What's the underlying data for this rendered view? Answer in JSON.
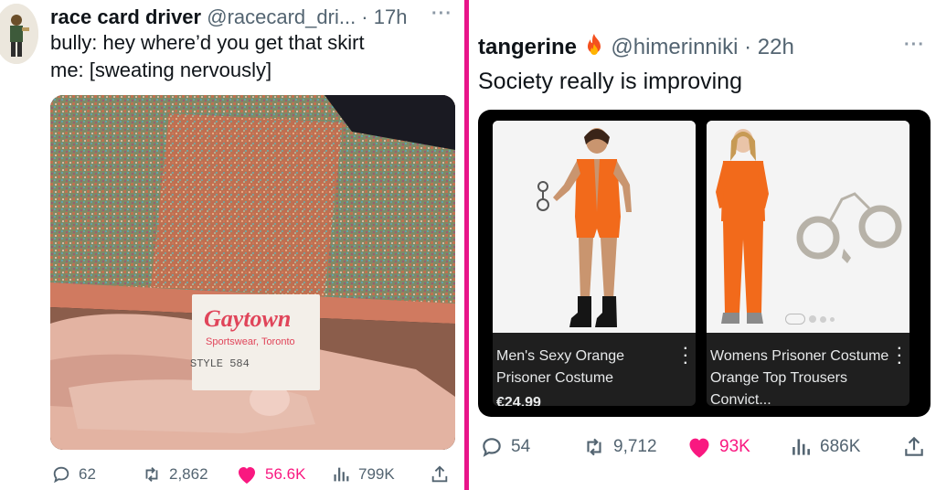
{
  "left_tweet": {
    "display_name": "race card driver",
    "handle_time": "@racecard_dri... · 17h",
    "text_line1": "bully: hey where’d you get that skirt",
    "text_line2": "me: [sweating nervously]",
    "tag_brand": "Gaytown",
    "tag_subtitle": "Sportswear, Toronto",
    "tag_style": "STYLE 584",
    "replies": "62",
    "retweets": "2,862",
    "likes": "56.6K",
    "views": "799K"
  },
  "right_tweet": {
    "display_name": "tangerine",
    "handle_time": "@himerinniki · 22h",
    "text": "Society really is improving",
    "products": [
      {
        "title": "Men's Sexy Orange Prisoner Costume",
        "price": "€24.99"
      },
      {
        "title": "Womens Prisoner Costume Orange Top Trousers Convict...",
        "price": ""
      }
    ],
    "replies": "54",
    "retweets": "9,712",
    "likes": "93K",
    "views": "686K"
  },
  "colors": {
    "divider": "#e8158a",
    "like": "#f91880",
    "muted": "#536471",
    "costume_orange": "#f26a1b"
  },
  "icons": [
    "more-icon",
    "fire-icon",
    "reply-icon",
    "retweet-icon",
    "like-icon",
    "views-icon",
    "share-icon",
    "kebab-icon"
  ]
}
